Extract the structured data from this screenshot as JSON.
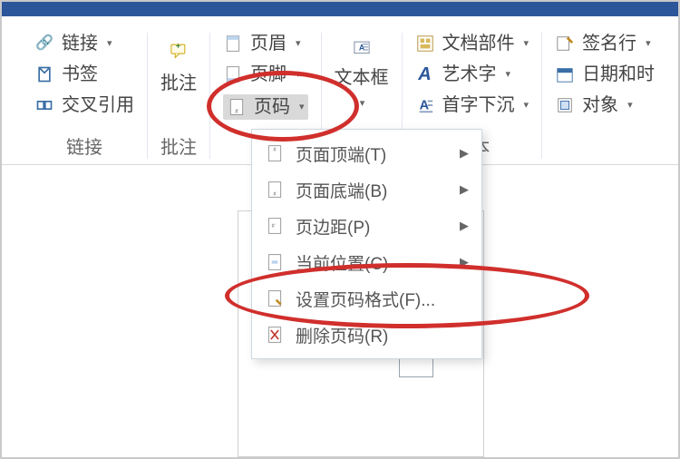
{
  "ribbon": {
    "links": {
      "hyperlink": "链接",
      "bookmark": "书签",
      "crossref": "交叉引用",
      "group_label": "链接"
    },
    "comments": {
      "comment": "批注",
      "group_label": "批注"
    },
    "hf": {
      "header": "页眉",
      "footer": "页脚",
      "page_number": "页码"
    },
    "text": {
      "textbox": "文本框",
      "quickparts": "文档部件",
      "wordart": "艺术字",
      "dropcap": "首字下沉",
      "group_label": "文本"
    },
    "text2": {
      "signature": "签名行",
      "datetime": "日期和时",
      "object": "对象"
    }
  },
  "menu": {
    "items": [
      {
        "label": "页面顶端(T)",
        "has_submenu": true
      },
      {
        "label": "页面底端(B)",
        "has_submenu": true
      },
      {
        "label": "页边距(P)",
        "has_submenu": true
      },
      {
        "label": "当前位置(C)",
        "has_submenu": true
      },
      {
        "label": "设置页码格式(F)...",
        "has_submenu": false
      },
      {
        "label": "删除页码(R)",
        "has_submenu": false
      }
    ]
  },
  "annotations": {
    "highlight_color": "#d02f2c",
    "circled_items": [
      "page-number-button",
      "menu-format-page-numbers"
    ]
  }
}
